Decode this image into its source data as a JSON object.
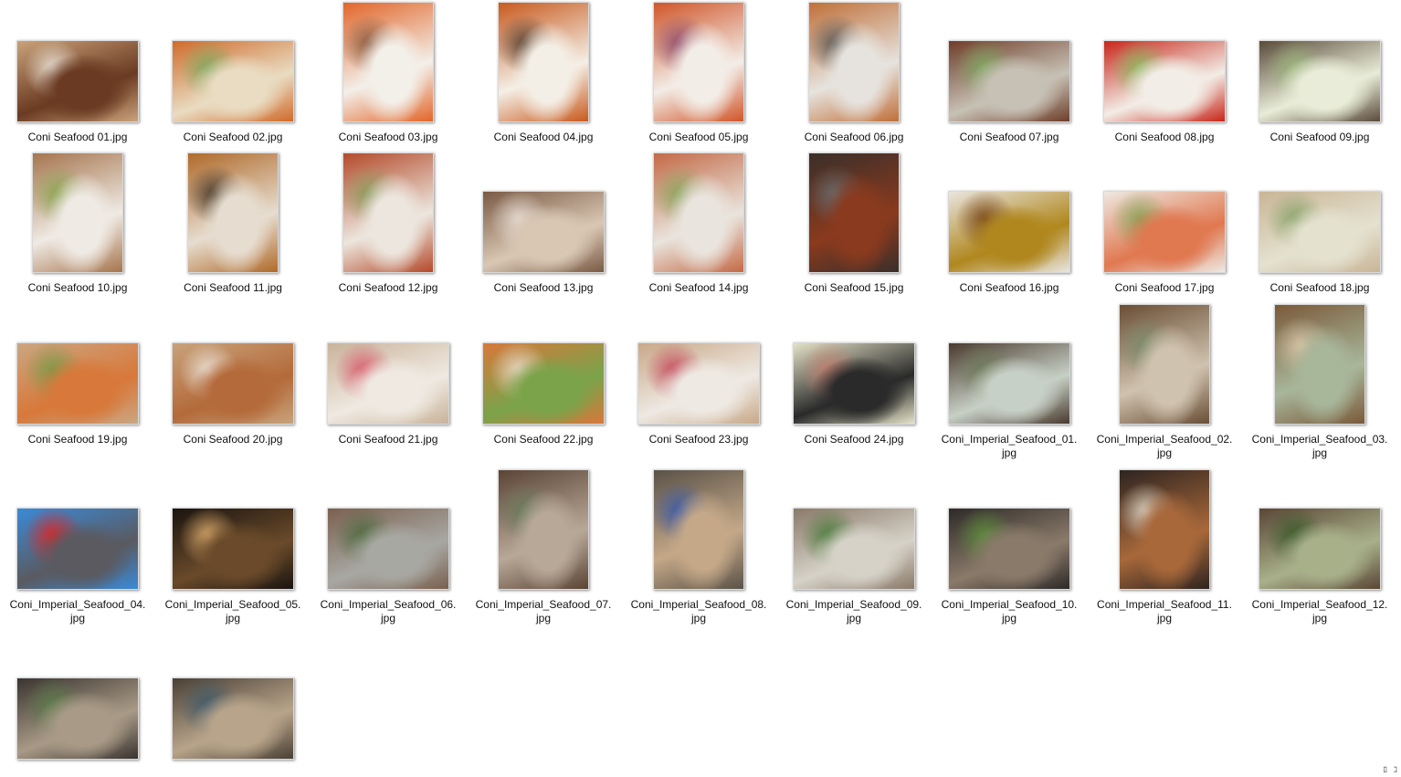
{
  "window": {
    "view": "large-icons",
    "background": "#ffffff"
  },
  "files": [
    {
      "name": "Coni Seafood 01.jpg",
      "orientation": "landscape",
      "colors": [
        "#c9a27a",
        "#6b3a22",
        "#e8e0d4"
      ]
    },
    {
      "name": "Coni Seafood 02.jpg",
      "orientation": "landscape",
      "colors": [
        "#d06a2a",
        "#e9dcc2",
        "#7fa65a"
      ]
    },
    {
      "name": "Coni Seafood 03.jpg",
      "orientation": "portrait",
      "colors": [
        "#e2662a",
        "#f3efe9",
        "#8a5a3c"
      ]
    },
    {
      "name": "Coni Seafood 04.jpg",
      "orientation": "portrait",
      "colors": [
        "#c85a1e",
        "#f4efe6",
        "#5b4332"
      ]
    },
    {
      "name": "Coni Seafood 05.jpg",
      "orientation": "portrait",
      "colors": [
        "#d0562a",
        "#f3ede7",
        "#8f4c6a"
      ]
    },
    {
      "name": "Coni Seafood 06.jpg",
      "orientation": "portrait",
      "colors": [
        "#c0703a",
        "#e6e3de",
        "#5e5a55"
      ]
    },
    {
      "name": "Coni Seafood 07.jpg",
      "orientation": "landscape",
      "colors": [
        "#6e3e2a",
        "#c7c1b5",
        "#7fa55e"
      ]
    },
    {
      "name": "Coni Seafood 08.jpg",
      "orientation": "landscape",
      "colors": [
        "#c8261a",
        "#f2ede6",
        "#8db35a"
      ]
    },
    {
      "name": "Coni Seafood 09.jpg",
      "orientation": "landscape",
      "colors": [
        "#5a4b3a",
        "#e8ecd8",
        "#9ab37a"
      ]
    },
    {
      "name": "Coni Seafood 10.jpg",
      "orientation": "portrait",
      "colors": [
        "#a6754e",
        "#efeae4",
        "#8aa34e"
      ]
    },
    {
      "name": "Coni Seafood 11.jpg",
      "orientation": "portrait",
      "colors": [
        "#b06a2a",
        "#e6ddd0",
        "#4a3a2a"
      ]
    },
    {
      "name": "Coni Seafood 12.jpg",
      "orientation": "portrait",
      "colors": [
        "#b44a2a",
        "#ece6de",
        "#8a9a5a"
      ]
    },
    {
      "name": "Coni Seafood 13.jpg",
      "orientation": "landscape",
      "colors": [
        "#7a5a44",
        "#d9c7b4",
        "#e4d8d0"
      ]
    },
    {
      "name": "Coni Seafood 14.jpg",
      "orientation": "portrait",
      "colors": [
        "#c46a46",
        "#e9e4dd",
        "#8aa35a"
      ]
    },
    {
      "name": "Coni Seafood 15.jpg",
      "orientation": "portrait",
      "colors": [
        "#3a2f2a",
        "#8a3a1e",
        "#6b6b6b"
      ]
    },
    {
      "name": "Coni Seafood 16.jpg",
      "orientation": "landscape",
      "colors": [
        "#e9e5df",
        "#b0871e",
        "#7a4a1e"
      ]
    },
    {
      "name": "Coni Seafood 17.jpg",
      "orientation": "landscape",
      "colors": [
        "#eee9e2",
        "#e07850",
        "#8aa35a"
      ]
    },
    {
      "name": "Coni Seafood 18.jpg",
      "orientation": "landscape",
      "colors": [
        "#c9b596",
        "#e4e1cf",
        "#8aa36a"
      ]
    },
    {
      "name": "Coni Seafood 19.jpg",
      "orientation": "landscape",
      "colors": [
        "#cba681",
        "#d8783a",
        "#7a9a4a"
      ]
    },
    {
      "name": "Coni Seafood 20.jpg",
      "orientation": "landscape",
      "colors": [
        "#c8a27a",
        "#b46a3a",
        "#e9e1d6"
      ]
    },
    {
      "name": "Coni Seafood 21.jpg",
      "orientation": "landscape",
      "colors": [
        "#c9b39a",
        "#efe9e1",
        "#d85a6a"
      ]
    },
    {
      "name": "Coni Seafood 22.jpg",
      "orientation": "landscape",
      "colors": [
        "#d8783a",
        "#7aa34a",
        "#e9d8c4"
      ]
    },
    {
      "name": "Coni Seafood 23.jpg",
      "orientation": "landscape",
      "colors": [
        "#c9a888",
        "#eee9e3",
        "#c44a5a"
      ]
    },
    {
      "name": "Coni Seafood 24.jpg",
      "orientation": "landscape",
      "colors": [
        "#e4e2c6",
        "#2a2a2a",
        "#c08070"
      ]
    },
    {
      "name": "Coni_Imperial_Seafood_01.jpg",
      "orientation": "landscape",
      "colors": [
        "#4a3a2e",
        "#c7d0c6",
        "#6e7a5a"
      ]
    },
    {
      "name": "Coni_Imperial_Seafood_02.jpg",
      "orientation": "portrait",
      "colors": [
        "#6a4e36",
        "#cfc2ae",
        "#7a8a6a"
      ]
    },
    {
      "name": "Coni_Imperial_Seafood_03.jpg",
      "orientation": "portrait",
      "colors": [
        "#7a5a3a",
        "#a8b69a",
        "#d8c4a6"
      ]
    },
    {
      "name": "Coni_Imperial_Seafood_04.jpg",
      "orientation": "landscape",
      "colors": [
        "#3a8ad8",
        "#5a5a60",
        "#d8282a"
      ]
    },
    {
      "name": "Coni_Imperial_Seafood_05.jpg",
      "orientation": "landscape",
      "colors": [
        "#1a1410",
        "#6a4a2a",
        "#d8a86a"
      ]
    },
    {
      "name": "Coni_Imperial_Seafood_06.jpg",
      "orientation": "landscape",
      "colors": [
        "#7a6050",
        "#a8a8a2",
        "#4e6a3e"
      ]
    },
    {
      "name": "Coni_Imperial_Seafood_07.jpg",
      "orientation": "portrait",
      "colors": [
        "#5a4436",
        "#b8a898",
        "#6a7a5a"
      ]
    },
    {
      "name": "Coni_Imperial_Seafood_08.jpg",
      "orientation": "portrait",
      "colors": [
        "#5a5248",
        "#c4a888",
        "#3a5aa8"
      ]
    },
    {
      "name": "Coni_Imperial_Seafood_09.jpg",
      "orientation": "landscape",
      "colors": [
        "#8a7a6a",
        "#d6d2c8",
        "#4a7a3a"
      ]
    },
    {
      "name": "Coni_Imperial_Seafood_10.jpg",
      "orientation": "landscape",
      "colors": [
        "#2e2a28",
        "#8a7a6a",
        "#5a8a3a"
      ]
    },
    {
      "name": "Coni_Imperial_Seafood_11.jpg",
      "orientation": "portrait",
      "colors": [
        "#2e2420",
        "#a8683a",
        "#d8d0c0"
      ]
    },
    {
      "name": "Coni_Imperial_Seafood_12.jpg",
      "orientation": "landscape",
      "colors": [
        "#5a4636",
        "#a8b08a",
        "#3a5a2a"
      ]
    },
    {
      "name": "",
      "orientation": "landscape",
      "colors": [
        "#3a3430",
        "#a89a86",
        "#5a7a4a"
      ]
    },
    {
      "name": "",
      "orientation": "landscape",
      "colors": [
        "#4a4036",
        "#b8a48a",
        "#3e5a6a"
      ]
    }
  ],
  "status_corner": "ﾛ⠀ｺ"
}
